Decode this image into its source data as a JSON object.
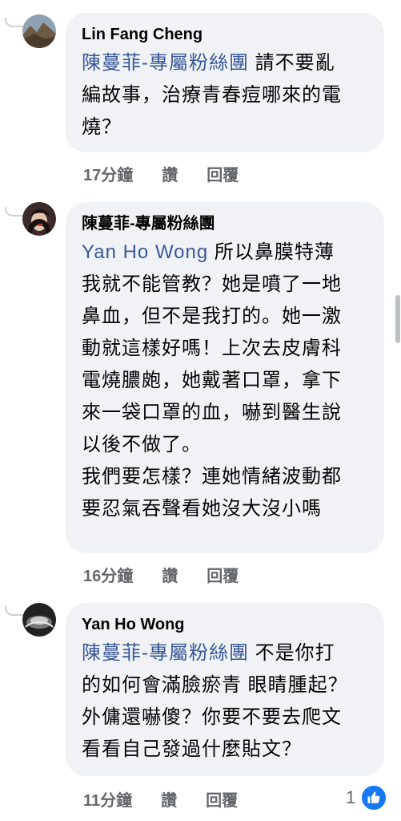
{
  "comments": [
    {
      "author": "Lin Fang Cheng",
      "mention": "陳蔓菲-專屬粉絲團",
      "lines": [
        "請不要亂",
        "編故事，治療青春痘哪來的電",
        "燒？"
      ],
      "time": "17分鐘",
      "like_label": "讚",
      "reply_label": "回覆"
    },
    {
      "author": "陳蔓菲-專屬粉絲團",
      "mention": "Yan Ho Wong",
      "lines": [
        "所以鼻膜特薄",
        "我就不能管教？她是噴了一地",
        "鼻血，但不是我打的。她一激",
        "動就這樣好嗎！上次去皮膚科",
        "電燒膿皰，她戴著口罩，拿下",
        "來一袋口罩的血，嚇到醫生說",
        "以後不做了。",
        "我們要怎樣？連她情緒波動都",
        "要忍氣吞聲看她沒大沒小嗎"
      ],
      "time": "16分鐘",
      "like_label": "讚",
      "reply_label": "回覆"
    },
    {
      "author": "Yan Ho Wong",
      "mention": "陳蔓菲-專屬粉絲團",
      "lines": [
        "不是你打",
        "的如何會滿臉瘀青 眼睛腫起？",
        "外傭還嚇傻？你要不要去爬文",
        "看看自己發過什麼貼文？"
      ],
      "time": "11分鐘",
      "like_label": "讚",
      "reply_label": "回覆",
      "reaction_count": "1",
      "reaction_icon": "like-icon"
    }
  ],
  "colors": {
    "mention": "#385898",
    "bubble": "#f0f2f5",
    "meta": "#65676b",
    "like": "#1877f2"
  }
}
